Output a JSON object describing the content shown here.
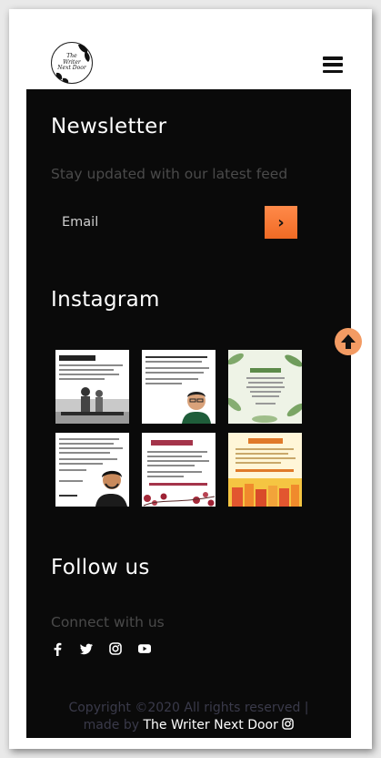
{
  "header": {
    "logo_lines": [
      "The",
      "Writer",
      "Next Door"
    ]
  },
  "newsletter": {
    "title": "Newsletter",
    "subtitle": "Stay updated with our latest feed",
    "email_placeholder": "Email",
    "submit_glyph": "›"
  },
  "instagram": {
    "title": "Instagram",
    "posts": [
      {
        "theme": "children-sketch"
      },
      {
        "theme": "man-avatar"
      },
      {
        "theme": "green-leaves"
      },
      {
        "theme": "man-sketch"
      },
      {
        "theme": "red-flowers"
      },
      {
        "theme": "yellow-note"
      }
    ]
  },
  "follow": {
    "title": "Follow us",
    "subtitle": "Connect with us",
    "icons": [
      "facebook-icon",
      "twitter-icon",
      "instagram-icon",
      "youtube-icon"
    ]
  },
  "footer": {
    "copyright_line1": "Copyright ©2020 All rights reserved |",
    "made_by": "made by",
    "brand": "The Writer Next Door"
  },
  "colors": {
    "accent": "#f06a24",
    "scroll_top": "#f39b63",
    "dark_bg": "#0a0a0a",
    "muted_text": "#4a4a4a"
  }
}
